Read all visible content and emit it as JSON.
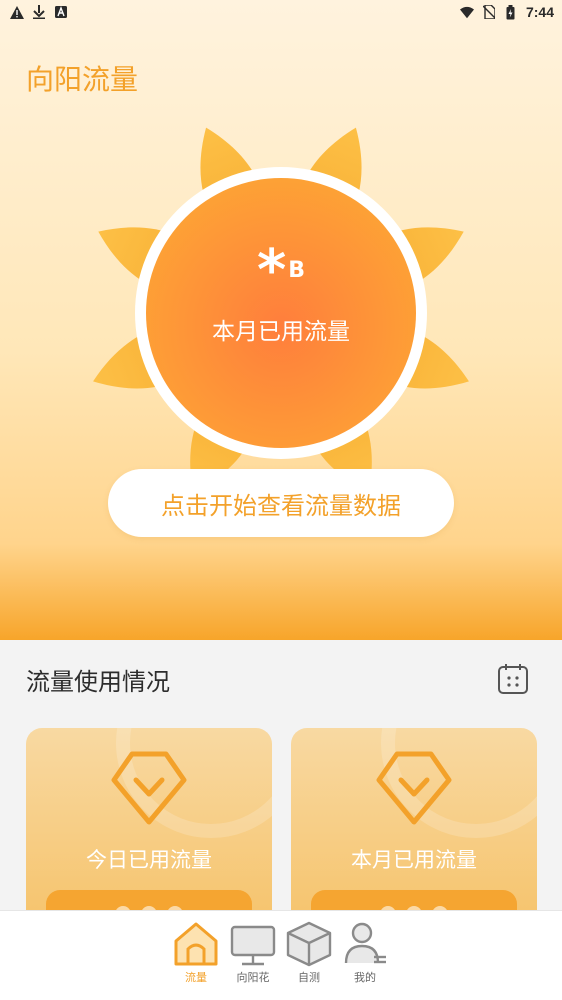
{
  "status_bar": {
    "time": "7:44",
    "left_icons": [
      "warning-icon",
      "download-icon",
      "font-a-icon"
    ],
    "right_icons": [
      "wifi-icon",
      "no-sim-icon",
      "battery-icon"
    ]
  },
  "app": {
    "title": "向阳流量",
    "accent_color": "#f3a12a"
  },
  "hero": {
    "usage_value": "*",
    "usage_unit": "B",
    "usage_label": "本月已用流量",
    "start_button_label": "点击开始查看流量数据"
  },
  "usage_section": {
    "title": "流量使用情况",
    "calendar_icon": "calendar-icon",
    "cards": [
      {
        "label": "今日已用流量",
        "icon": "down-arrow-badge-icon"
      },
      {
        "label": "本月已用流量",
        "icon": "down-arrow-badge-icon"
      }
    ]
  },
  "bottom_nav": {
    "items": [
      {
        "label": "流量",
        "icon": "home-icon",
        "active": true
      },
      {
        "label": "向阳花",
        "icon": "monitor-icon",
        "active": false
      },
      {
        "label": "自测",
        "icon": "box-icon",
        "active": false
      },
      {
        "label": "我的",
        "icon": "user-icon",
        "active": false
      }
    ]
  }
}
